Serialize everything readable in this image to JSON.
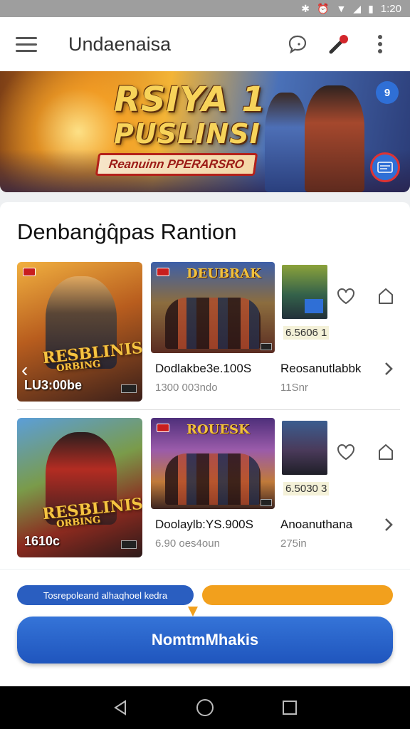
{
  "status_bar": {
    "time": "1:20",
    "icons": [
      "bluetooth-icon",
      "alarm-icon",
      "wifi-icon",
      "signal-icon",
      "battery-icon"
    ]
  },
  "app_bar": {
    "title": "Undaenaisa",
    "icons": [
      "menu-icon",
      "chat-icon",
      "microphone-icon",
      "more-vert-icon"
    ]
  },
  "banner": {
    "title_line1": "RSIYA 1",
    "title_line2": "PUSLINSI",
    "ribbon": "Reanuinn PPERARSRO",
    "badge_top": "9"
  },
  "section": {
    "title": "Denbanġq̂pas Rantion"
  },
  "rows": [
    {
      "big_tile": {
        "logo_line1": "RESBLINIS",
        "logo_line2": "ORBING",
        "price": "LU3:00be"
      },
      "mid_tile": {
        "logo": "DEUBRAK",
        "title": "Dodlakbe3e.100S",
        "subtitle": "1300 003ndo"
      },
      "small_tile": {
        "title": "Reosanutlabbk",
        "subtitle": "11Snr",
        "price": "6.5606 1"
      }
    },
    {
      "big_tile": {
        "logo_line1": "RESBLINIS",
        "logo_line2": "ORBING",
        "price": "1610c"
      },
      "mid_tile": {
        "logo": "ROUESK",
        "title": "Doolaylb:YS.900S",
        "subtitle": "6.90 oes4oun"
      },
      "small_tile": {
        "title": "Anoanuthana",
        "subtitle": "275in",
        "price": "6.5030 3"
      }
    }
  ],
  "bottom": {
    "progress_label": "Tosrepoleand alhaqhoel kedra",
    "button_label": "NomtmMhakis"
  },
  "colors": {
    "accent_blue": "#2a5ec0",
    "accent_orange": "#f2a01d",
    "status_bar": "#9e9e9e"
  }
}
